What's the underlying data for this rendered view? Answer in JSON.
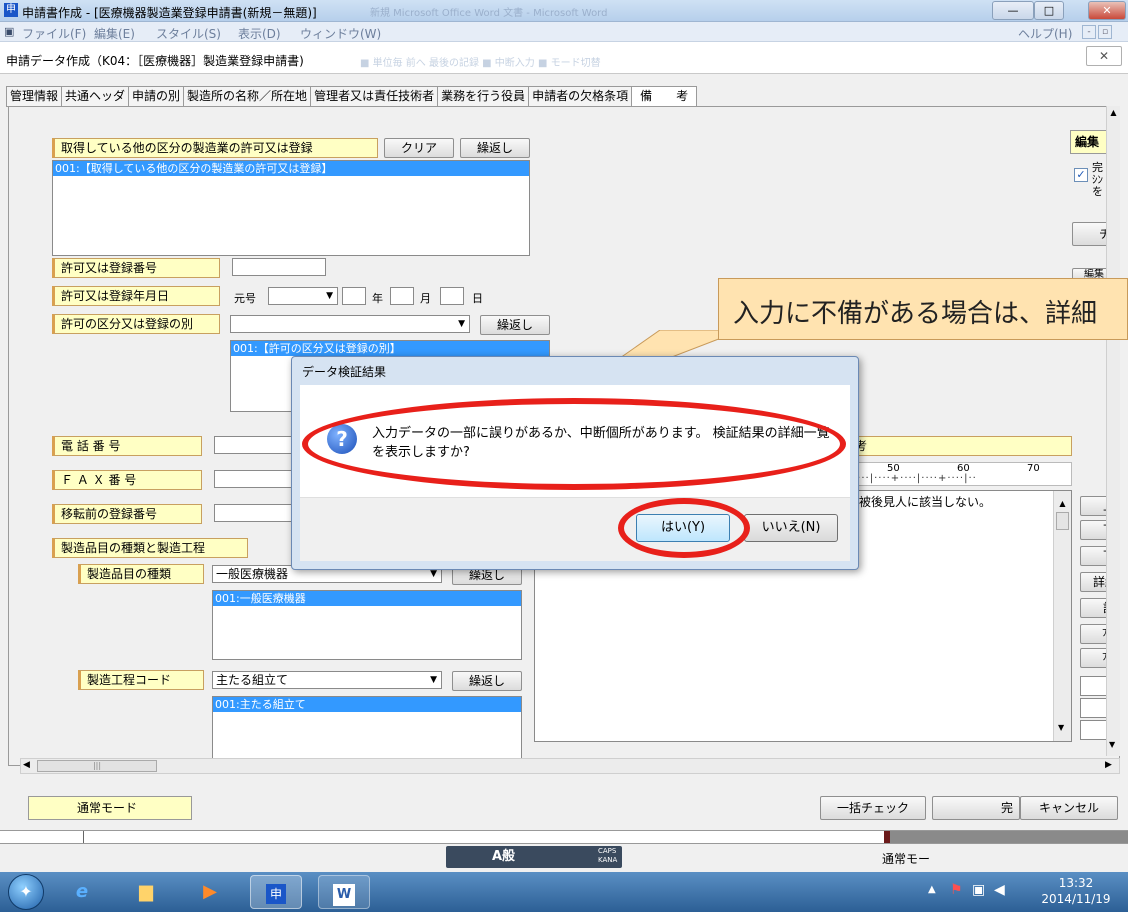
{
  "window": {
    "title": "申請書作成 - [医療機器製造業登録申請書(新規－無題)]",
    "app_icon": "申",
    "faded_title": "新規 Microsoft Office Word 文書 - Microsoft Word"
  },
  "menu": {
    "items": [
      "ファイル(F)",
      "編集(E)",
      "スタイル(S)",
      "表示(D)",
      "ウィンドウ(W)"
    ],
    "help": "ヘルプ(H)"
  },
  "form": {
    "title": "申請データ作成（K04：［医療機器］製造業登録申請書)",
    "faded": "■ 単位毎 前へ 最後の記録  ■ 中断入力 ■ モード切替"
  },
  "tabs": [
    "管理情報",
    "共通ヘッダ",
    "申請の別",
    "製造所の名称／所在地",
    "管理者又は責任技術者",
    "業務を行う役員",
    "申請者の欠格条項",
    "備　　考"
  ],
  "left": {
    "other_permit_label": "取得している他の区分の製造業の許可又は登録",
    "clear_btn": "クリア",
    "repeat_btn": "繰返し",
    "other_permit_item": "001:【取得している他の区分の製造業の許可又は登録】",
    "permit_no_label": "許可又は登録番号",
    "permit_date_label": "許可又は登録年月日",
    "era": "元号",
    "year": "年",
    "month": "月",
    "day": "日",
    "permit_kind_label": "許可の区分又は登録の別",
    "permit_kind_item": "001:【許可の区分又は登録の別】",
    "tel_label": "電 話 番 号",
    "fax_label": "Ｆ Ａ Ｘ 番 号",
    "prev_reg_label": "移転前の登録番号",
    "product_header": "製造品目の種類と製造工程",
    "product_type_label": "製造品目の種類",
    "product_type_value": "一般医療機器",
    "product_type_item": "001:一般医療機器",
    "process_label": "製造工程コード",
    "process_value": "主たる組立て",
    "process_item": "001:主たる組立て"
  },
  "right": {
    "edit_btn": "編集",
    "complete": "完",
    "checkbox_label": "ｼﾝ",
    "checkbox_label2": "を",
    "chi_btn": "チ",
    "edit_btn2": "編集",
    "remarks_label_tail": "考",
    "ruler": [
      "50",
      "60",
      "70"
    ],
    "remarks_text": "年被後見人に該当しない。",
    "side_buttons": [
      "上",
      "下",
      "下",
      "詳細",
      "記",
      "ﾌｧｲ",
      "ﾌｧｲ"
    ]
  },
  "callout": {
    "text": "入力に不備がある場合は、詳細"
  },
  "dialog": {
    "title": "データ検証結果",
    "message": "入力データの一部に誤りがあるか、中断個所があります。 検証結果の詳細一覧を表示しますか?",
    "yes": "はい(Y)",
    "no": "いいえ(N)"
  },
  "bottom": {
    "mode": "通常モード",
    "check_all": "一括チェック",
    "complete": "完",
    "cancel": "キャンセル",
    "status_mode": "通常モー"
  },
  "taskbar": {
    "time": "13:32",
    "date": "2014/11/19",
    "ime": "A般",
    "caps": "CAPS",
    "kana": "KANA"
  },
  "colors": {
    "label_bg": "#ffffc4",
    "selection": "#3399ff",
    "highlight_ring": "#e8201a",
    "callout": "#ffe3b0"
  }
}
